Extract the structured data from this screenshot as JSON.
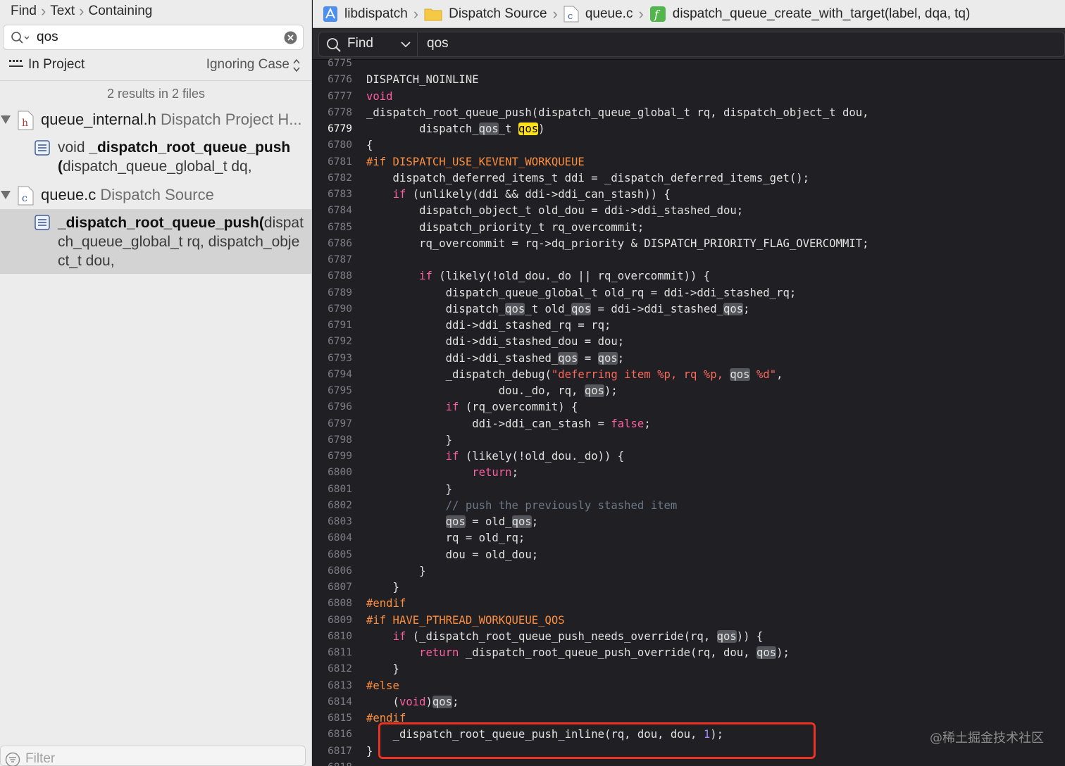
{
  "navigator": {
    "breadcrumb": [
      "Find",
      "Text",
      "Containing"
    ],
    "search": {
      "value": "qos"
    },
    "scope": {
      "label": "In Project",
      "case": "Ignoring Case"
    },
    "summary": "2 results in 2 files",
    "groups": [
      {
        "file": "queue_internal.h",
        "desc": " Dispatch Project H...",
        "icon_letter": "h",
        "match": {
          "prefix": "void ",
          "bold": "_dispatch_root_queue_push",
          "line2_bold": "(",
          "line2": "dispatch_queue_global_t dq,"
        }
      },
      {
        "file": "queue.c",
        "desc": " Dispatch Source",
        "icon_letter": "c",
        "match": {
          "bold": "_dispatch_root_queue_push(",
          "rest": "dispatch_queue_global_t rq, dispatch_object_t dou,"
        }
      }
    ],
    "filter_placeholder": "Filter"
  },
  "editor": {
    "jumpbar": {
      "project": "libdispatch",
      "group": "Dispatch Source",
      "file": "queue.c",
      "file_icon_letter": "c",
      "function": "dispatch_queue_create_with_target(label, dqa, tq)",
      "function_icon_letter": "f"
    },
    "find": {
      "mode": "Find",
      "query": "qos"
    },
    "current_line": "6779",
    "lines": [
      {
        "n": "6775",
        "t": []
      },
      {
        "n": "6776",
        "t": [
          [
            "",
            "DISPATCH_NOINLINE"
          ]
        ]
      },
      {
        "n": "6777",
        "t": [
          [
            "k",
            "void"
          ]
        ]
      },
      {
        "n": "6778",
        "t": [
          [
            "",
            "_dispatch_root_queue_push(dispatch_queue_global_t rq, dispatch_object_t dou,"
          ]
        ]
      },
      {
        "n": "6779",
        "t": [
          [
            "",
            "        dispatch_"
          ],
          [
            "m",
            "qos"
          ],
          [
            "",
            "_t "
          ],
          [
            "mc",
            "qos"
          ],
          [
            "",
            ")"
          ]
        ]
      },
      {
        "n": "6780",
        "t": [
          [
            "",
            "{"
          ]
        ]
      },
      {
        "n": "6781",
        "t": [
          [
            "p",
            "#if DISPATCH_USE_KEVENT_WORKQUEUE"
          ]
        ]
      },
      {
        "n": "6782",
        "t": [
          [
            "",
            "    dispatch_deferred_items_t ddi = _dispatch_deferred_items_get();"
          ]
        ]
      },
      {
        "n": "6783",
        "t": [
          [
            "",
            "    "
          ],
          [
            "k",
            "if"
          ],
          [
            "",
            " (unlikely(ddi && ddi->ddi_can_stash)) {"
          ]
        ]
      },
      {
        "n": "6784",
        "t": [
          [
            "",
            "        dispatch_object_t old_dou = ddi->ddi_stashed_dou;"
          ]
        ]
      },
      {
        "n": "6785",
        "t": [
          [
            "",
            "        dispatch_priority_t rq_overcommit;"
          ]
        ]
      },
      {
        "n": "6786",
        "t": [
          [
            "",
            "        rq_overcommit = rq->dq_priority & DISPATCH_PRIORITY_FLAG_OVERCOMMIT;"
          ]
        ]
      },
      {
        "n": "6787",
        "t": []
      },
      {
        "n": "6788",
        "t": [
          [
            "",
            "        "
          ],
          [
            "k",
            "if"
          ],
          [
            "",
            " (likely(!old_dou._do || rq_overcommit)) {"
          ]
        ]
      },
      {
        "n": "6789",
        "t": [
          [
            "",
            "            dispatch_queue_global_t old_rq = ddi->ddi_stashed_rq;"
          ]
        ]
      },
      {
        "n": "6790",
        "t": [
          [
            "",
            "            dispatch_"
          ],
          [
            "m",
            "qos"
          ],
          [
            "",
            "_t old_"
          ],
          [
            "m",
            "qos"
          ],
          [
            "",
            " = ddi->ddi_stashed_"
          ],
          [
            "m",
            "qos"
          ],
          [
            "",
            ";"
          ]
        ]
      },
      {
        "n": "6791",
        "t": [
          [
            "",
            "            ddi->ddi_stashed_rq = rq;"
          ]
        ]
      },
      {
        "n": "6792",
        "t": [
          [
            "",
            "            ddi->ddi_stashed_dou = dou;"
          ]
        ]
      },
      {
        "n": "6793",
        "t": [
          [
            "",
            "            ddi->ddi_stashed_"
          ],
          [
            "m",
            "qos"
          ],
          [
            "",
            " = "
          ],
          [
            "m",
            "qos"
          ],
          [
            "",
            ";"
          ]
        ]
      },
      {
        "n": "6794",
        "t": [
          [
            "",
            "            _dispatch_debug("
          ],
          [
            "s",
            "\"deferring item %p, rq %p, "
          ],
          [
            "m",
            "qos"
          ],
          [
            "s",
            " %d\""
          ],
          [
            "",
            ","
          ]
        ]
      },
      {
        "n": "6795",
        "t": [
          [
            "",
            "                    dou._do, rq, "
          ],
          [
            "m",
            "qos"
          ],
          [
            "",
            ");"
          ]
        ]
      },
      {
        "n": "6796",
        "t": [
          [
            "",
            "            "
          ],
          [
            "k",
            "if"
          ],
          [
            "",
            " (rq_overcommit) {"
          ]
        ]
      },
      {
        "n": "6797",
        "t": [
          [
            "",
            "                ddi->ddi_can_stash = "
          ],
          [
            "k",
            "false"
          ],
          [
            "",
            ";"
          ]
        ]
      },
      {
        "n": "6798",
        "t": [
          [
            "",
            "            }"
          ]
        ]
      },
      {
        "n": "6799",
        "t": [
          [
            "",
            "            "
          ],
          [
            "k",
            "if"
          ],
          [
            "",
            " (likely(!old_dou._do)) {"
          ]
        ]
      },
      {
        "n": "6800",
        "t": [
          [
            "",
            "                "
          ],
          [
            "k",
            "return"
          ],
          [
            "",
            ";"
          ]
        ]
      },
      {
        "n": "6801",
        "t": [
          [
            "",
            "            }"
          ]
        ]
      },
      {
        "n": "6802",
        "t": [
          [
            "",
            "            "
          ],
          [
            "c",
            "// push the previously stashed item"
          ]
        ]
      },
      {
        "n": "6803",
        "t": [
          [
            "",
            "            "
          ],
          [
            "m",
            "qos"
          ],
          [
            "",
            " = old_"
          ],
          [
            "m",
            "qos"
          ],
          [
            "",
            ";"
          ]
        ]
      },
      {
        "n": "6804",
        "t": [
          [
            "",
            "            rq = old_rq;"
          ]
        ]
      },
      {
        "n": "6805",
        "t": [
          [
            "",
            "            dou = old_dou;"
          ]
        ]
      },
      {
        "n": "6806",
        "t": [
          [
            "",
            "        }"
          ]
        ]
      },
      {
        "n": "6807",
        "t": [
          [
            "",
            "    }"
          ]
        ]
      },
      {
        "n": "6808",
        "t": [
          [
            "p",
            "#endif"
          ]
        ]
      },
      {
        "n": "6809",
        "t": [
          [
            "p",
            "#if HAVE_PTHREAD_WORKQUEUE_QOS"
          ]
        ]
      },
      {
        "n": "6810",
        "t": [
          [
            "",
            "    "
          ],
          [
            "k",
            "if"
          ],
          [
            "",
            " (_dispatch_root_queue_push_needs_override(rq, "
          ],
          [
            "m",
            "qos"
          ],
          [
            "",
            ")) {"
          ]
        ]
      },
      {
        "n": "6811",
        "t": [
          [
            "",
            "        "
          ],
          [
            "k",
            "return"
          ],
          [
            "",
            " _dispatch_root_queue_push_override(rq, dou, "
          ],
          [
            "m",
            "qos"
          ],
          [
            "",
            ");"
          ]
        ]
      },
      {
        "n": "6812",
        "t": [
          [
            "",
            "    }"
          ]
        ]
      },
      {
        "n": "6813",
        "t": [
          [
            "p",
            "#else"
          ]
        ]
      },
      {
        "n": "6814",
        "t": [
          [
            "",
            "    ("
          ],
          [
            "k",
            "void"
          ],
          [
            "",
            ")"
          ],
          [
            "m",
            "qos"
          ],
          [
            "",
            ";"
          ]
        ]
      },
      {
        "n": "6815",
        "t": [
          [
            "p",
            "#endif"
          ]
        ]
      },
      {
        "n": "6816",
        "t": [
          [
            "",
            "    _dispatch_root_queue_push_inline(rq, dou, dou, "
          ],
          [
            "n",
            "1"
          ],
          [
            "",
            ");"
          ]
        ]
      },
      {
        "n": "6817",
        "t": [
          [
            "",
            "}"
          ]
        ]
      },
      {
        "n": "6818",
        "t": []
      }
    ]
  },
  "watermark": "@稀土掘金技术社区",
  "colors": {
    "highlight_box": "#ea3323",
    "current_match": "#ffe11a",
    "keyword": "#fc5fa3",
    "preprocessor": "#fd8f3f",
    "string": "#fc6a5d"
  }
}
